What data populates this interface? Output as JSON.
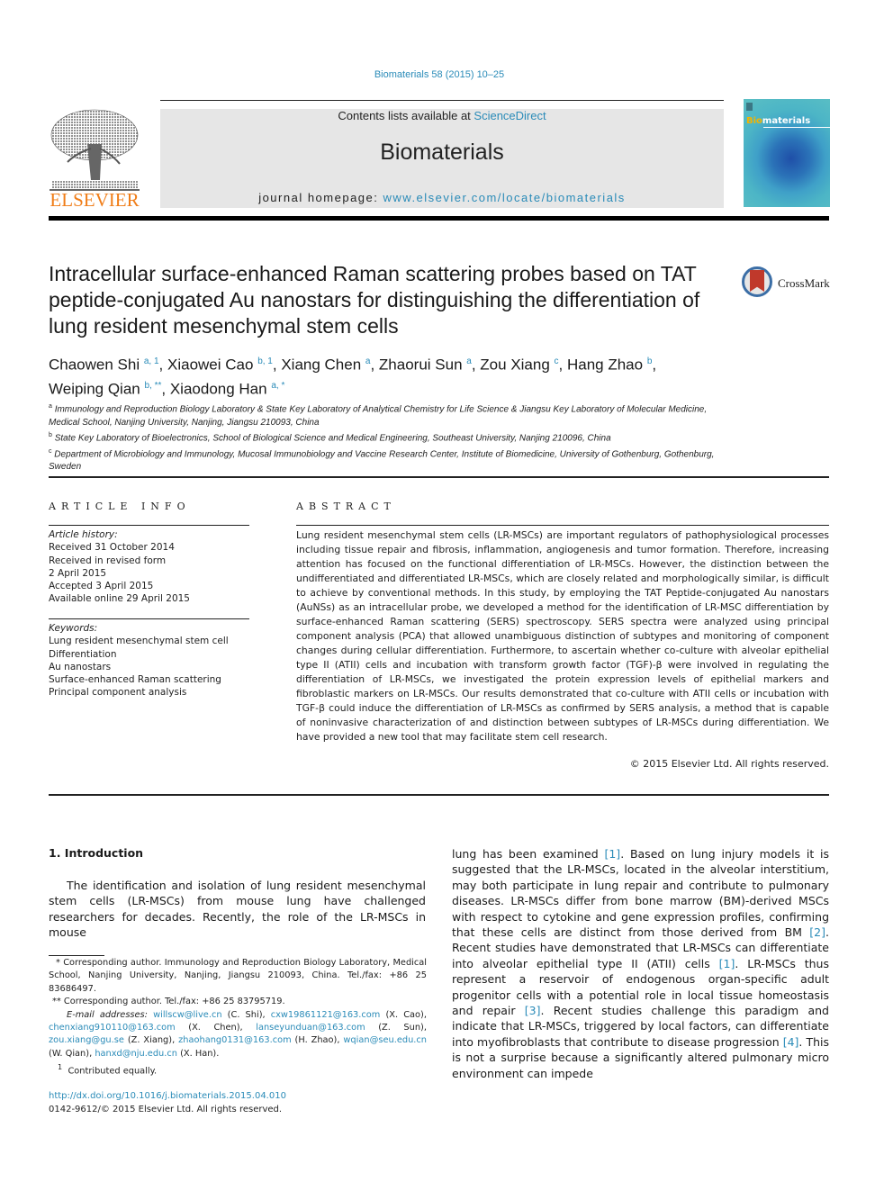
{
  "journal_citation": "Biomaterials 58 (2015) 10–25",
  "header": {
    "publisher_logo_text": "ELSEVIER",
    "contents_prefix": "Contents lists available at ",
    "contents_link": "ScienceDirect",
    "journal_title": "Biomaterials",
    "homepage_prefix": "journal homepage: ",
    "homepage_link": "www.elsevier.com/locate/biomaterials",
    "cover_title_bio": "Bio",
    "cover_title_rest": "materials"
  },
  "crossmark_label": "CrossMark",
  "article": {
    "title": "Intracellular surface-enhanced Raman scattering probes based on TAT peptide-conjugated Au nanostars for distinguishing the differentiation of lung resident mesenchymal stem cells",
    "authors": [
      {
        "name": "Chaowen Shi",
        "sup": "a, 1",
        "sep": ", "
      },
      {
        "name": "Xiaowei Cao",
        "sup": "b, 1",
        "sep": ", "
      },
      {
        "name": "Xiang Chen",
        "sup": "a",
        "sep": ", "
      },
      {
        "name": "Zhaorui Sun",
        "sup": "a",
        "sep": ", "
      },
      {
        "name": "Zou Xiang",
        "sup": "c",
        "sep": ", "
      },
      {
        "name": "Hang Zhao",
        "sup": "b",
        "sep": ","
      },
      {
        "name": "Weiping Qian",
        "sup": "b, **",
        "sep": ", "
      },
      {
        "name": "Xiaodong Han",
        "sup": "a, *",
        "sep": ""
      }
    ],
    "affiliations": [
      {
        "mark": "a",
        "text": "Immunology and Reproduction Biology Laboratory & State Key Laboratory of Analytical Chemistry for Life Science & Jiangsu Key Laboratory of Molecular Medicine, Medical School, Nanjing University, Nanjing, Jiangsu 210093, China"
      },
      {
        "mark": "b",
        "text": "State Key Laboratory of Bioelectronics, School of Biological Science and Medical Engineering, Southeast University, Nanjing 210096, China"
      },
      {
        "mark": "c",
        "text": "Department of Microbiology and Immunology, Mucosal Immunobiology and Vaccine Research Center, Institute of Biomedicine, University of Gothenburg, Gothenburg, Sweden"
      }
    ]
  },
  "article_info": {
    "heading": "ARTICLE INFO",
    "history_label": "Article history:",
    "history": [
      "Received 31 October 2014",
      "Received in revised form",
      "2 April 2015",
      "Accepted 3 April 2015",
      "Available online 29 April 2015"
    ],
    "keywords_label": "Keywords:",
    "keywords": [
      "Lung resident mesenchymal stem cell",
      "Differentiation",
      "Au nanostars",
      "Surface-enhanced Raman scattering",
      "Principal component analysis"
    ]
  },
  "abstract": {
    "heading": "ABSTRACT",
    "text": "Lung resident mesenchymal stem cells (LR-MSCs) are important regulators of pathophysiological processes including tissue repair and fibrosis, inflammation, angiogenesis and tumor formation. Therefore, increasing attention has focused on the functional differentiation of LR-MSCs. However, the distinction between the undifferentiated and differentiated LR-MSCs, which are closely related and morphologically similar, is difficult to achieve by conventional methods. In this study, by employing the TAT Peptide-conjugated Au nanostars (AuNSs) as an intracellular probe, we developed a method for the identification of LR-MSC differentiation by surface-enhanced Raman scattering (SERS) spectroscopy. SERS spectra were analyzed using principal component analysis (PCA) that allowed unambiguous distinction of subtypes and monitoring of component changes during cellular differentiation. Furthermore, to ascertain whether co-culture with alveolar epithelial type II (ATII) cells and incubation with transform growth factor (TGF)-β were involved in regulating the differentiation of LR-MSCs, we investigated the protein expression levels of epithelial markers and fibroblastic markers on LR-MSCs. Our results demonstrated that co-culture with ATII cells or incubation with TGF-β could induce the differentiation of LR-MSCs as confirmed by SERS analysis, a method that is capable of noninvasive characterization of and distinction between subtypes of LR-MSCs during differentiation. We have provided a new tool that may facilitate stem cell research.",
    "copyright": "© 2015 Elsevier Ltd. All rights reserved."
  },
  "introduction": {
    "heading": "1.  Introduction",
    "left_para": "The identification and isolation of lung resident mesenchymal stem cells (LR-MSCs) from mouse lung have challenged researchers for decades. Recently, the role of the LR-MSCs in mouse",
    "right_segments": [
      {
        "t": "lung has been examined "
      },
      {
        "ref": "[1]"
      },
      {
        "t": ". Based on lung injury models it is suggested that the LR-MSCs, located in the alveolar interstitium, may both participate in lung repair and contribute to pulmonary diseases. LR-MSCs differ from bone marrow (BM)-derived MSCs with respect to cytokine and gene expression profiles, confirming that these cells are distinct from those derived from BM "
      },
      {
        "ref": "[2]"
      },
      {
        "t": ". Recent studies have demonstrated that LR-MSCs can differentiate into alveolar epithelial type II (ATII) cells "
      },
      {
        "ref": "[1]"
      },
      {
        "t": ". LR-MSCs thus represent a reservoir of endogenous organ-specific adult progenitor cells with a potential role in local tissue homeostasis and repair "
      },
      {
        "ref": "[3]"
      },
      {
        "t": ". Recent studies challenge this paradigm and indicate that LR-MSCs, triggered by local factors, can differentiate into myofibroblasts that contribute to disease progression "
      },
      {
        "ref": "[4]"
      },
      {
        "t": ". This is not a surprise because a significantly altered pulmonary micro environment can impede"
      }
    ]
  },
  "footnotes": {
    "corr1": "* Corresponding author. Immunology and Reproduction Biology Laboratory, Medical School, Nanjing University, Nanjing, Jiangsu 210093, China. Tel./fax: +86 25 83686497.",
    "corr2": "** Corresponding author. Tel./fax: +86 25 83795719.",
    "email_label": "E-mail addresses:",
    "emails": [
      {
        "email": "willscw@live.cn",
        "who": " (C. Shi), "
      },
      {
        "email": "cxw19861121@163.com",
        "who": " (X. Cao), "
      },
      {
        "email": "chenxiang910110@163.com",
        "who": " (X. Chen), "
      },
      {
        "email": "lanseyunduan@163.com",
        "who": " (Z. Sun), "
      },
      {
        "email": "zou.xiang@gu.se",
        "who": " (Z. Xiang), "
      },
      {
        "email": "zhaohang0131@163.com",
        "who": " (H. Zhao), "
      },
      {
        "email": "wqian@seu.edu.cn",
        "who": " (W. Qian), "
      },
      {
        "email": "hanxd@nju.edu.cn",
        "who": " (X. Han)."
      }
    ],
    "equal": "Contributed equally.",
    "equal_mark": "1"
  },
  "doi": {
    "link": "http://dx.doi.org/10.1016/j.biomaterials.2015.04.010",
    "issn": "0142-9612/© 2015 Elsevier Ltd. All rights reserved."
  },
  "colors": {
    "link": "#2a8bb8",
    "elsevier_orange": "#f07d18",
    "banner_bg": "#e6e6e6"
  }
}
